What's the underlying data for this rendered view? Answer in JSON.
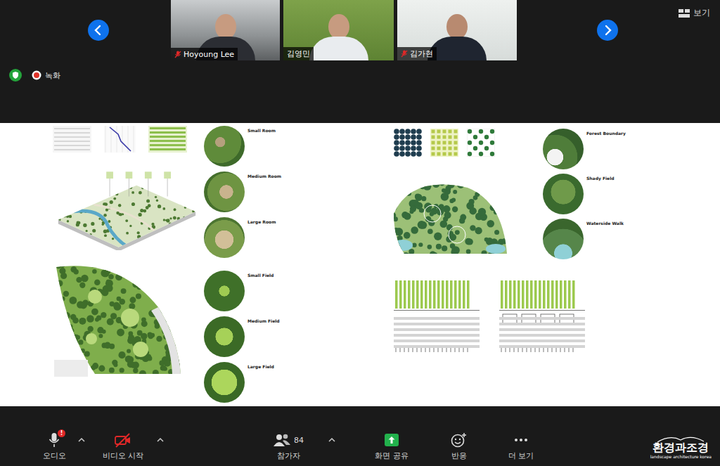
{
  "top_bar": {
    "view_button": "보기",
    "recording": "녹화"
  },
  "participants": [
    {
      "name": "Hoyoung Lee",
      "muted": true
    },
    {
      "name": "김영민",
      "muted": false
    },
    {
      "name": "김가현",
      "muted": true
    }
  ],
  "shared_screen": {
    "left_board": {
      "room_labels": [
        "Small Room",
        "Medium Room",
        "Large Room"
      ],
      "field_labels": [
        "Small Field",
        "Medium Field",
        "Large Field"
      ]
    },
    "right_board": {
      "labels": [
        "Forest Boundary",
        "Shady Field",
        "Waterside Walk"
      ]
    }
  },
  "toolbar": [
    {
      "kind": "audio",
      "label": "오디오",
      "badge": "!",
      "menu": true,
      "off": false
    },
    {
      "kind": "video",
      "label": "비디오 시작",
      "menu": true,
      "off": true
    },
    {
      "kind": "participants",
      "label": "참가자",
      "count": "84",
      "menu": true
    },
    {
      "kind": "share",
      "label": "화면 공유",
      "menu": false
    },
    {
      "kind": "reactions",
      "label": "반응",
      "menu": false
    },
    {
      "kind": "more",
      "label": "더 보기",
      "menu": false
    }
  ],
  "watermark": {
    "title": "환경과조경",
    "subtitle": "landscape architecture korea"
  }
}
